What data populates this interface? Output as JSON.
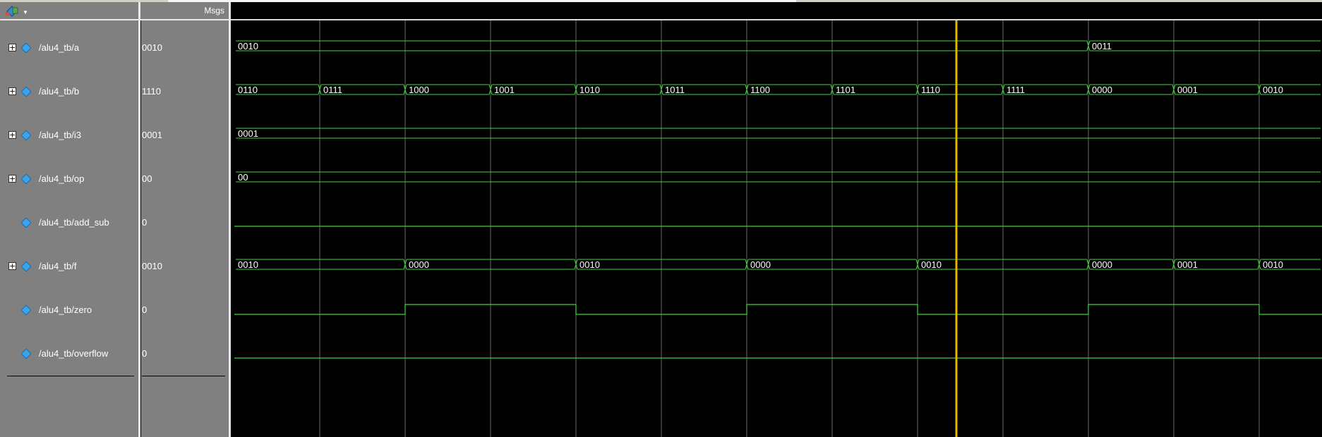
{
  "header": {
    "msgs_label": "Msgs",
    "menu_icon": "wave-menu-icon"
  },
  "colors": {
    "wave": "#3fd43f",
    "cursor": "#e6b800",
    "grid": "#6a6a6a",
    "text": "#ffffff",
    "panel": "#808080"
  },
  "signals": [
    {
      "name": "/alu4_tb/a",
      "value": "0010",
      "bus": true
    },
    {
      "name": "/alu4_tb/b",
      "value": "1110",
      "bus": true
    },
    {
      "name": "/alu4_tb/i3",
      "value": "0001",
      "bus": true
    },
    {
      "name": "/alu4_tb/op",
      "value": "00",
      "bus": true
    },
    {
      "name": "/alu4_tb/add_sub",
      "value": "0",
      "bus": false
    },
    {
      "name": "/alu4_tb/f",
      "value": "0010",
      "bus": true
    },
    {
      "name": "/alu4_tb/zero",
      "value": "0",
      "bus": false
    },
    {
      "name": "/alu4_tb/overflow",
      "value": "0",
      "bus": false
    }
  ],
  "waves": {
    "a": [
      "0010",
      "0011"
    ],
    "b": [
      "0110",
      "0111",
      "1000",
      "1001",
      "1010",
      "1011",
      "1100",
      "1101",
      "1110",
      "1111",
      "0000",
      "0001",
      "0010"
    ],
    "i3": [
      "0001"
    ],
    "op": [
      "00"
    ],
    "f": [
      "0010",
      "0000",
      "0010",
      "0000",
      "0010",
      "0000",
      "0001",
      "0010"
    ],
    "zero": [
      0,
      1,
      0,
      1,
      0,
      1,
      0
    ],
    "add_sub": 0,
    "overflow": 0
  }
}
